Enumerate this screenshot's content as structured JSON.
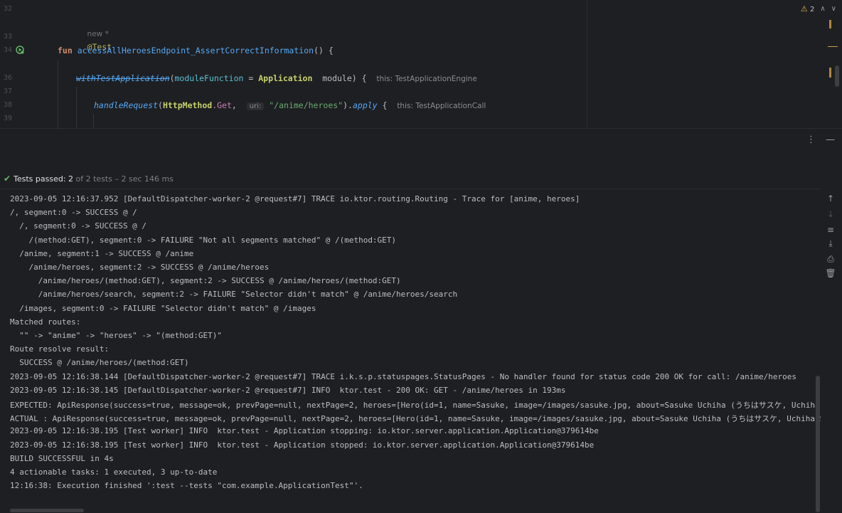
{
  "editor": {
    "line_numbers": [
      "32",
      "33",
      "34",
      "36",
      "37",
      "38",
      "39"
    ],
    "new_hint": "new *",
    "annotation": "@Test",
    "fun_keyword": "fun",
    "function_name": "accessAllHeroesEndpoint_AssertCorrectInformation",
    "fun_tail": "() {",
    "with_test_app": "withTestApplication",
    "paren_open": "(",
    "module_function_param": "moduleFunction",
    "equals": " = ",
    "application_class": "Application",
    "module_ref": "  module) {",
    "hint_engine": "this: TestApplicationEngine",
    "handle_request": "handleRequest",
    "http_method_class": "HttpMethod",
    "get_prop": ".Get",
    "comma": ", ",
    "uri_hint": "uri:",
    "uri_value": "\"/anime/heroes\"",
    "paren_close": ").",
    "apply_fn": "apply",
    "brace": " {",
    "hint_call": "this: TestApplicationCall",
    "warning_count": "2"
  },
  "tool_window": {
    "more_icon": "⋮",
    "minimize_icon": "—"
  },
  "status": {
    "passed_label": "Tests passed: 2",
    "rest_label": " of 2 tests – 2 sec 146 ms"
  },
  "console": {
    "lines": [
      "2023-09-05 12:16:37.952 [DefaultDispatcher-worker-2 @request#7] TRACE io.ktor.routing.Routing - Trace for [anime, heroes]",
      "/, segment:0 -> SUCCESS @ /",
      "  /, segment:0 -> SUCCESS @ /",
      "    /(method:GET), segment:0 -> FAILURE \"Not all segments matched\" @ /(method:GET)",
      "  /anime, segment:1 -> SUCCESS @ /anime",
      "    /anime/heroes, segment:2 -> SUCCESS @ /anime/heroes",
      "      /anime/heroes/(method:GET), segment:2 -> SUCCESS @ /anime/heroes/(method:GET)",
      "      /anime/heroes/search, segment:2 -> FAILURE \"Selector didn't match\" @ /anime/heroes/search",
      "  /images, segment:0 -> FAILURE \"Selector didn't match\" @ /images",
      "Matched routes:",
      "  \"\" -> \"anime\" -> \"heroes\" -> \"(method:GET)\"",
      "Route resolve result:",
      "  SUCCESS @ /anime/heroes/(method:GET)",
      "2023-09-05 12:16:38.144 [DefaultDispatcher-worker-2 @request#7] TRACE i.k.s.p.statuspages.StatusPages - No handler found for status code 200 OK for call: /anime/heroes",
      "2023-09-05 12:16:38.145 [DefaultDispatcher-worker-2 @request#7] INFO  ktor.test - 200 OK: GET - /anime/heroes in 193ms",
      "EXPECTED: ApiResponse(success=true, message=ok, prevPage=null, nextPage=2, heroes=[Hero(id=1, name=Sasuke, image=/images/sasuke.jpg, about=Sasuke Uchiha (うちはサスケ, Uchiha Sasuke",
      "ACTUAL : ApiResponse(success=true, message=ok, prevPage=null, nextPage=2, heroes=[Hero(id=1, name=Sasuke, image=/images/sasuke.jpg, about=Sasuke Uchiha (うちはサスケ, Uchiha Sasuke",
      "2023-09-05 12:16:38.195 [Test worker] INFO  ktor.test - Application stopping: io.ktor.server.application.Application@379614be",
      "2023-09-05 12:16:38.195 [Test worker] INFO  ktor.test - Application stopped: io.ktor.server.application.Application@379614be",
      "BUILD SUCCESSFUL in 4s",
      "4 actionable tasks: 1 executed, 3 up-to-date",
      "12:16:38: Execution finished ':test --tests \"com.example.ApplicationTest\"'."
    ]
  }
}
